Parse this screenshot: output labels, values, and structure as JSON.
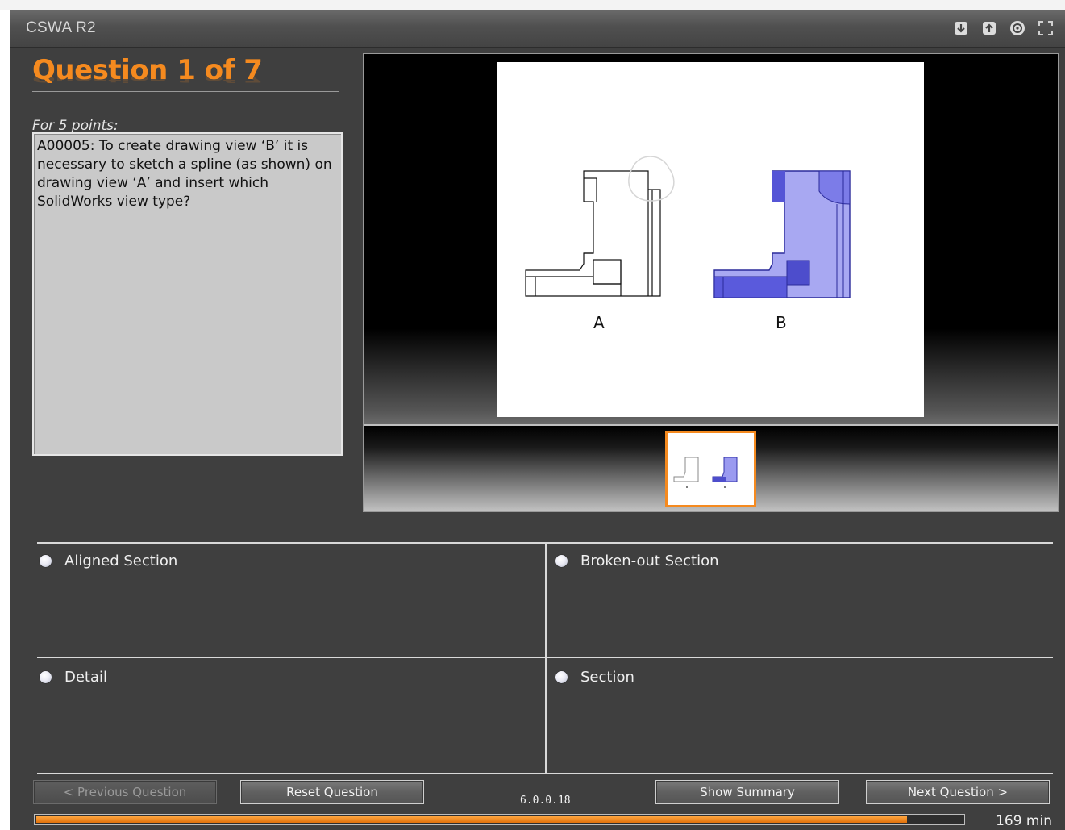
{
  "window": {
    "title": "CSWA R2",
    "toolbar_icons": [
      "download-icon",
      "upload-icon",
      "help-icon",
      "fullscreen-icon"
    ]
  },
  "question": {
    "title": "Question 1 of 7",
    "points_label": "For 5 points:",
    "text": "A00005:  To create drawing view ‘B’ it is necessary to sketch a spline (as shown) on drawing view ‘A’ and insert which SolidWorks view type?"
  },
  "drawing": {
    "view_a_label": "A",
    "view_b_label": "B"
  },
  "options": [
    {
      "label": "Aligned Section"
    },
    {
      "label": "Broken-out Section"
    },
    {
      "label": "Detail"
    },
    {
      "label": "Section"
    }
  ],
  "buttons": {
    "previous": "< Previous Question",
    "reset": "Reset Question",
    "summary": "Show Summary",
    "next": "Next Question >"
  },
  "version": "6.0.0.18",
  "progress": {
    "fraction": 0.94,
    "time_remaining": "169 min"
  },
  "colors": {
    "accent": "#f58a1f",
    "section_fill": "#8a8aee",
    "background": "#3f3f3f"
  }
}
